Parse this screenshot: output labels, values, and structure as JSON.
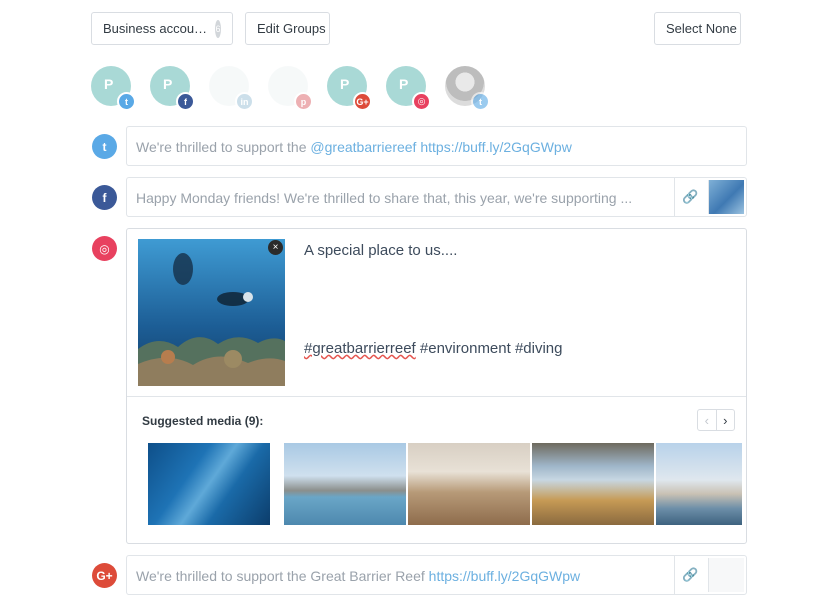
{
  "toolbar": {
    "account_label": "Business accou…",
    "account_count": "6",
    "edit_groups_label": "Edit Groups",
    "select_none_label": "Select None"
  },
  "profiles": [
    {
      "initial": "P",
      "network": "twitter-icon"
    },
    {
      "initial": "P",
      "network": "facebook-icon"
    },
    {
      "initial": "",
      "network": "linkedin-icon"
    },
    {
      "initial": "",
      "network": "pinterest-icon"
    },
    {
      "initial": "P",
      "network": "google-plus-icon"
    },
    {
      "initial": "P",
      "network": "instagram-icon"
    },
    {
      "initial": "",
      "network": "twitter-icon"
    }
  ],
  "posts": {
    "twitter": {
      "text": "We're thrilled to support the ",
      "mention": "@greatbarriereef",
      "url": "https://buff.ly/2GqGWpw"
    },
    "facebook": {
      "text": "Happy Monday friends! We're thrilled to share that, this year, we're supporting ..."
    },
    "instagram": {
      "line1": "A special place to us....",
      "hashtag1": "#greatbarrierreef",
      "hashtags_rest": " #environment #diving",
      "close_label": "×",
      "suggested_label": "Suggested media (9):",
      "prev_label": "‹",
      "next_label": "›"
    },
    "googleplus": {
      "text": "We're thrilled to support the Great Barrier Reef ",
      "url": "https://buff.ly/2GqGWpw"
    }
  },
  "icons": {
    "twitter": "twitter-icon",
    "facebook": "facebook-icon",
    "instagram": "instagram-icon",
    "googleplus": "google-plus-icon",
    "link": "link-icon"
  },
  "colors": {
    "twitter": "#5aa9e6",
    "facebook": "#3b5998",
    "instagram": "#e8415f",
    "googleplus": "#dd4b39",
    "link": "#6cb0e0"
  }
}
